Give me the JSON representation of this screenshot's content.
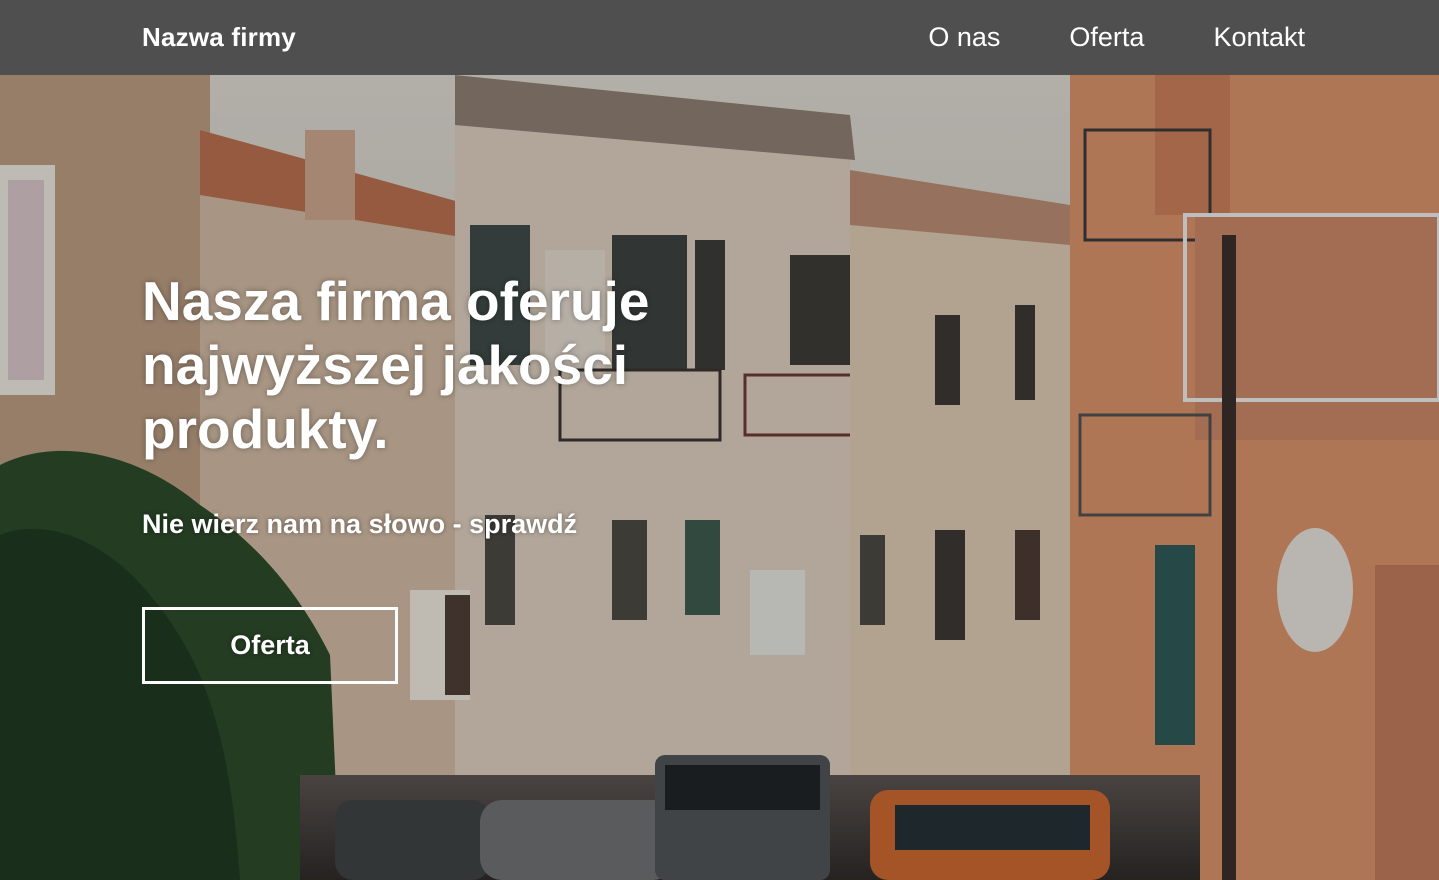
{
  "header": {
    "brand": "Nazwa firmy",
    "nav": [
      {
        "label": "O nas"
      },
      {
        "label": "Oferta"
      },
      {
        "label": "Kontakt"
      }
    ]
  },
  "hero": {
    "headline": "Nasza firma oferuje najwyższej jakości produkty.",
    "subline": "Nie wierz nam na słowo - sprawdź",
    "cta_label": "Oferta"
  },
  "colors": {
    "header_bg": "#4f4f4f",
    "text": "#ffffff"
  }
}
